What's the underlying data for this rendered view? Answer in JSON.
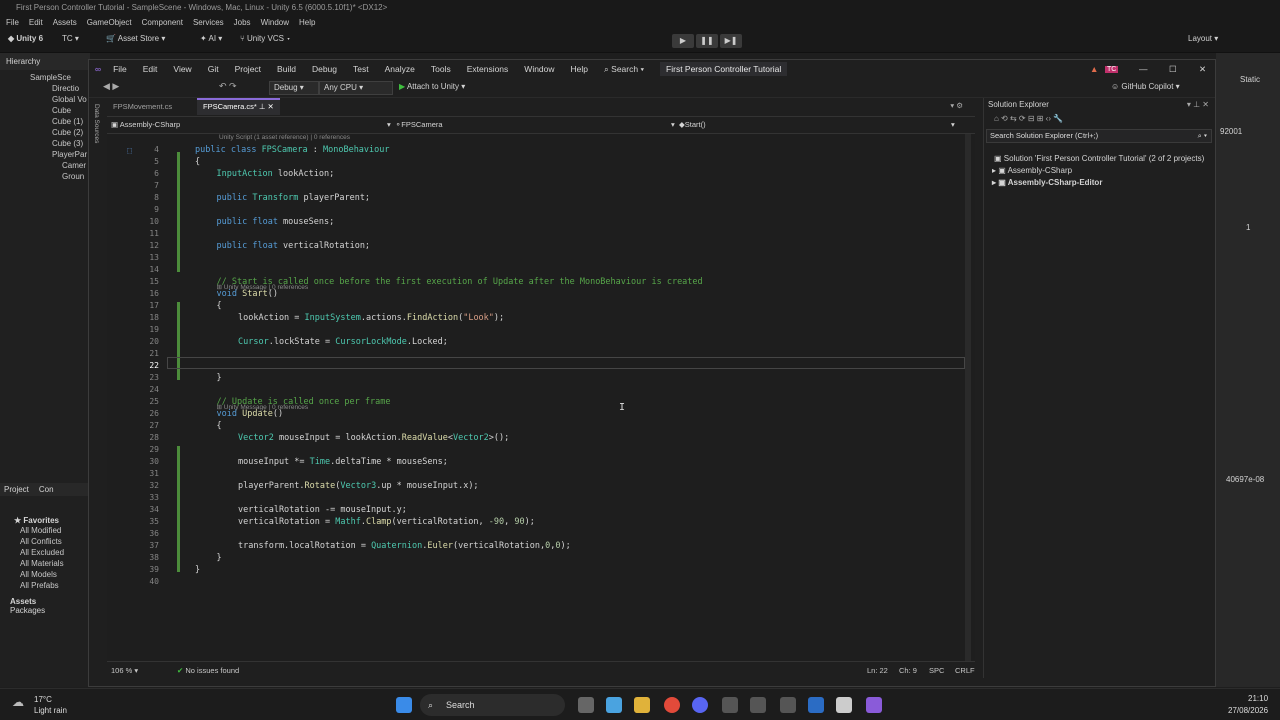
{
  "unity": {
    "title": "First Person Controller Tutorial - SampleScene - Windows, Mac, Linux - Unity 6.5 (6000.5.10f1)* <DX12>",
    "menu": [
      "File",
      "Edit",
      "Assets",
      "GameObject",
      "Component",
      "Services",
      "Jobs",
      "Window",
      "Help"
    ],
    "account": "Unity 6",
    "tc": "TC",
    "asset_store": "Asset Store",
    "ai": "AI",
    "vcs": "Unity VCS",
    "layout": "Layout",
    "hierarchy_tab": "Hierarchy",
    "hierarchy_items": [
      "SampleSce",
      "Directio",
      "Global Vo",
      "Cube",
      "Cube (1)",
      "Cube (2)",
      "Cube (3)",
      "PlayerPar",
      "Camer",
      "Groun"
    ],
    "project_tab": "Project",
    "console_tab": "Con",
    "favorites": "Favorites",
    "favorite_items": [
      "All Modified",
      "All Conflicts",
      "All Excluded",
      "All Materials",
      "All Models",
      "All Prefabs"
    ],
    "assets": "Assets",
    "packages": "Packages",
    "inspector_static": "Static",
    "inspector_value1": "92001",
    "inspector_value2": "1",
    "inspector_value3": "40697e-08"
  },
  "vs": {
    "menu": [
      "File",
      "Edit",
      "View",
      "Git",
      "Project",
      "Build",
      "Debug",
      "Test",
      "Analyze",
      "Tools",
      "Extensions",
      "Window",
      "Help"
    ],
    "search": "Search",
    "solution_name": "First Person Controller Tutorial",
    "user": "TC",
    "config": "Debug",
    "platform": "Any CPU",
    "attach": "Attach to Unity",
    "copilot": "GitHub Copilot",
    "tabs": [
      "FPSMovement.cs",
      "FPSCamera.cs*"
    ],
    "nav_project": "Assembly-CSharp",
    "nav_class": "FPSCamera",
    "nav_member": "Start()",
    "code_lens_top": "Unity Script (1 asset reference) | 0 references",
    "status_zoom": "106 %",
    "status_issues": "No issues found",
    "status_ln": "Ln: 22",
    "status_ch": "Ch: 9",
    "status_spc": "SPC",
    "status_crlf": "CRLF",
    "side_label": "Data Sources"
  },
  "solution_explorer": {
    "title": "Solution Explorer",
    "search_placeholder": "Search Solution Explorer (Ctrl+;)",
    "solution": "Solution 'First Person Controller Tutorial' (2 of 2 projects)",
    "projects": [
      "Assembly-CSharp",
      "Assembly-CSharp-Editor"
    ]
  },
  "code": {
    "line_numbers": [
      "4",
      "5",
      "6",
      "7",
      "8",
      "9",
      "10",
      "11",
      "12",
      "13",
      "14",
      "15",
      "16",
      "17",
      "18",
      "19",
      "20",
      "21",
      "22",
      "23",
      "24",
      "25",
      "26",
      "27",
      "28",
      "29",
      "30",
      "31",
      "32",
      "33",
      "34",
      "35",
      "36",
      "37",
      "38",
      "39",
      "40"
    ],
    "lens_start": "Unity Message | 0 references",
    "lens_update": "Unity Message | 0 references",
    "l4": [
      "public",
      "class",
      "FPSCamera",
      ":",
      "MonoBehaviour"
    ],
    "l6": [
      "InputAction",
      "lookAction;"
    ],
    "l8": [
      "public",
      "Transform",
      "playerParent;"
    ],
    "l10": [
      "public",
      "float",
      "mouseSens;"
    ],
    "l12": [
      "public",
      "float",
      "verticalRotation;"
    ],
    "l15": "// Start is called once before the first execution of Update after the MonoBehaviour is created",
    "l16": [
      "void",
      "Start",
      "()"
    ],
    "l18": [
      "lookAction = ",
      "InputSystem",
      ".actions.",
      "FindAction",
      "(",
      "\"Look\"",
      ");"
    ],
    "l20": [
      "Cursor",
      ".lockState = ",
      "CursorLockMode",
      ".Locked;"
    ],
    "l25": "// Update is called once per frame",
    "l26": [
      "void",
      "Update",
      "()"
    ],
    "l28": [
      "Vector2",
      " mouseInput = lookAction.",
      "ReadValue",
      "<",
      "Vector2",
      ">();"
    ],
    "l30": [
      "mouseInput *= ",
      "Time",
      ".deltaTime * mouseSens;"
    ],
    "l32": [
      "playerParent.",
      "Rotate",
      "(",
      "Vector3",
      ".up * mouseInput.x);"
    ],
    "l34": [
      "verticalRotation -= mouseInput.y;"
    ],
    "l35": [
      "verticalRotation = ",
      "Mathf",
      ".",
      "Clamp",
      "(verticalRotation, ",
      "-90",
      ", ",
      "90",
      ");"
    ],
    "l37": [
      "transform.localRotation = ",
      "Quaternion",
      ".",
      "Euler",
      "(verticalRotation,",
      "0",
      ",",
      "0",
      ");"
    ]
  },
  "taskbar": {
    "weather_temp": "17°C",
    "weather_desc": "Light rain",
    "search": "Search",
    "time": "21:10",
    "date": "27/08/2026"
  },
  "colors": {
    "keyword": "#569cd6",
    "type": "#4ec9b0",
    "comment": "#57a64a",
    "string": "#d69d85",
    "method": "#dcdcaa",
    "accent": "#8a6bd9"
  }
}
